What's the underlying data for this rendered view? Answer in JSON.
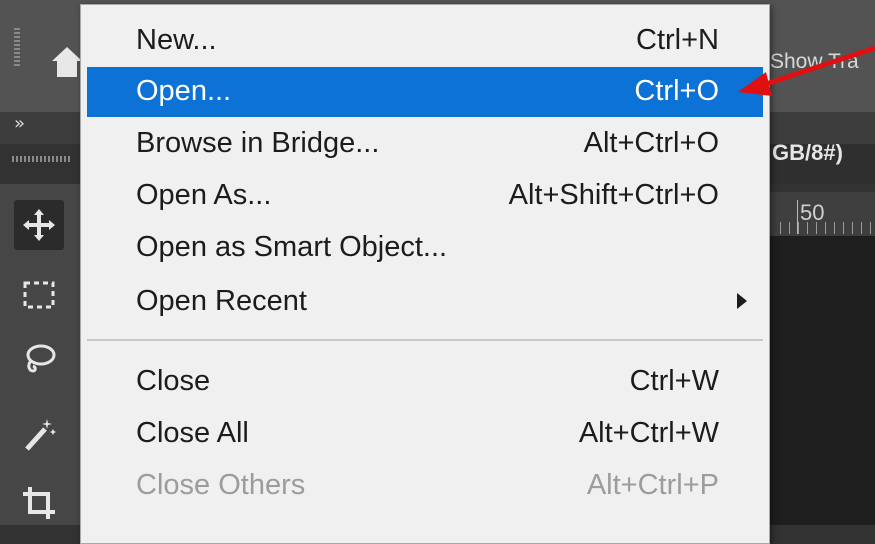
{
  "background": {
    "options_bar_text": "Show Tra",
    "document_tab_text": "GB/8#)",
    "ruler_value": "50",
    "collapse_chevron": "»"
  },
  "tools": [
    "move-tool-icon",
    "rectangular-marquee-icon",
    "lasso-icon",
    "magic-wand-icon",
    "crop-icon"
  ],
  "menu": {
    "items": [
      {
        "label": "New...",
        "shortcut": "Ctrl+N",
        "state": "normal"
      },
      {
        "label": "Open...",
        "shortcut": "Ctrl+O",
        "state": "highlighted"
      },
      {
        "label": "Browse in Bridge...",
        "shortcut": "Alt+Ctrl+O",
        "state": "normal"
      },
      {
        "label": "Open As...",
        "shortcut": "Alt+Shift+Ctrl+O",
        "state": "normal"
      },
      {
        "label": "Open as Smart Object...",
        "shortcut": "",
        "state": "normal"
      },
      {
        "label": "Open Recent",
        "shortcut": "",
        "state": "normal",
        "submenu": true
      },
      {
        "label": "Close",
        "shortcut": "Ctrl+W",
        "state": "normal"
      },
      {
        "label": "Close All",
        "shortcut": "Alt+Ctrl+W",
        "state": "normal"
      },
      {
        "label": "Close Others",
        "shortcut": "Alt+Ctrl+P",
        "state": "disabled"
      }
    ]
  },
  "colors": {
    "highlight": "#0c72d6",
    "annotation_arrow": "#e01010",
    "menu_bg": "#f0f0f0"
  }
}
